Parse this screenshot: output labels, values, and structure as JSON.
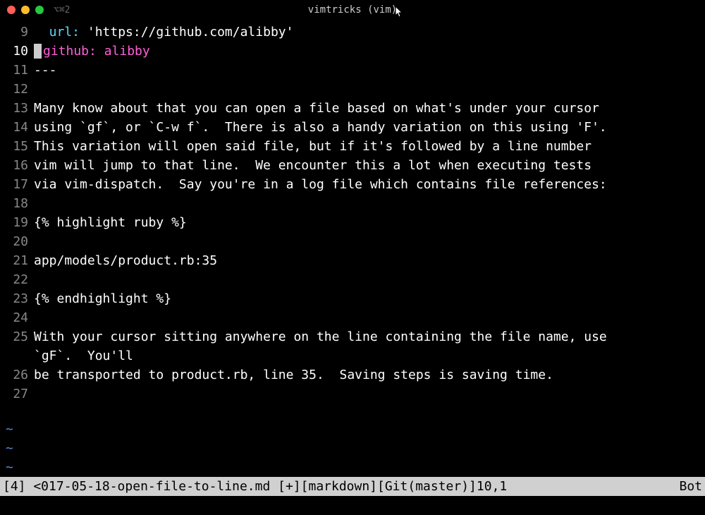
{
  "titlebar": {
    "shortcut": "⌥⌘2",
    "title": "vimtricks (vim)"
  },
  "lines": [
    {
      "num": "9",
      "segments": [
        {
          "cls": "key-lit",
          "text": "  url: "
        },
        {
          "cls": "string",
          "text": "'https://github.com/alibby'"
        }
      ]
    },
    {
      "num": "10",
      "current": true,
      "cursor": true,
      "segments": [
        {
          "cls": "key-mag",
          "text": "github: alibby"
        }
      ]
    },
    {
      "num": "11",
      "segments": [
        {
          "cls": "",
          "text": "---"
        }
      ]
    },
    {
      "num": "12",
      "segments": [
        {
          "cls": "",
          "text": ""
        }
      ]
    },
    {
      "num": "13",
      "segments": [
        {
          "cls": "",
          "text": "Many know about that you can open a file based on what's under your cursor"
        }
      ]
    },
    {
      "num": "14",
      "segments": [
        {
          "cls": "",
          "text": "using `gf`, or `C-w f`.  There is also a handy variation on this using 'F'."
        }
      ]
    },
    {
      "num": "15",
      "segments": [
        {
          "cls": "",
          "text": "This variation will open said file, but if it's followed by a line number"
        }
      ]
    },
    {
      "num": "16",
      "segments": [
        {
          "cls": "",
          "text": "vim will jump to that line.  We encounter this a lot when executing tests"
        }
      ]
    },
    {
      "num": "17",
      "segments": [
        {
          "cls": "",
          "text": "via vim-dispatch.  Say you're in a log file which contains file references:"
        }
      ]
    },
    {
      "num": "18",
      "segments": [
        {
          "cls": "",
          "text": ""
        }
      ]
    },
    {
      "num": "19",
      "segments": [
        {
          "cls": "",
          "text": "{% highlight ruby %}"
        }
      ]
    },
    {
      "num": "20",
      "segments": [
        {
          "cls": "",
          "text": ""
        }
      ]
    },
    {
      "num": "21",
      "segments": [
        {
          "cls": "",
          "text": "app/models/product.rb:35"
        }
      ]
    },
    {
      "num": "22",
      "segments": [
        {
          "cls": "",
          "text": ""
        }
      ]
    },
    {
      "num": "23",
      "segments": [
        {
          "cls": "",
          "text": "{% endhighlight %}"
        }
      ]
    },
    {
      "num": "24",
      "segments": [
        {
          "cls": "",
          "text": ""
        }
      ]
    },
    {
      "num": "25",
      "segments": [
        {
          "cls": "",
          "text": "With your cursor sitting anywhere on the line containing the file name, use"
        }
      ],
      "wrap": "`gF`.  You'll"
    },
    {
      "num": "26",
      "segments": [
        {
          "cls": "",
          "text": "be transported to product.rb, line 35.  Saving steps is saving time."
        }
      ]
    },
    {
      "num": "27",
      "segments": [
        {
          "cls": "",
          "text": ""
        }
      ]
    }
  ],
  "tildes": [
    "~",
    "~",
    "~"
  ],
  "statusline": {
    "left": "[4] <017-05-18-open-file-to-line.md [+][markdown][Git(master)]10,1",
    "right": "Bot"
  }
}
